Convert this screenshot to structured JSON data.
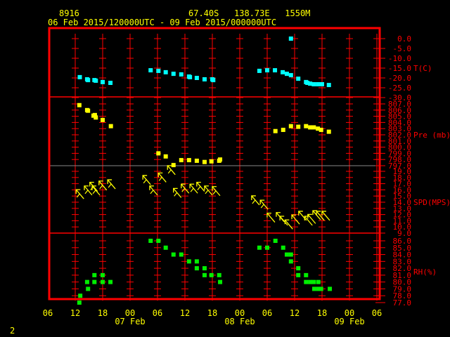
{
  "header": {
    "station": "8916",
    "location": "67.40S   138.73E   1550M",
    "period": "06 Feb 2015/120000UTC - 09 Feb 2015/000000UTC"
  },
  "page_number": "2",
  "colors": {
    "frame": "#ff0000",
    "text": "#ffff00",
    "temp": "#00ffff",
    "pressure": "#ffff00",
    "wind": "#ffff00",
    "rh": "#00ee00"
  },
  "chart_data": {
    "type": "scatter",
    "x_units": "hours after 06 Feb 2015 06UTC",
    "xlim": [
      0,
      72
    ],
    "x_ticks": [
      {
        "h": 0,
        "label": "06"
      },
      {
        "h": 6,
        "label": "12"
      },
      {
        "h": 12,
        "label": "18"
      },
      {
        "h": 18,
        "label": "00"
      },
      {
        "h": 24,
        "label": "06"
      },
      {
        "h": 30,
        "label": "12"
      },
      {
        "h": 36,
        "label": "18"
      },
      {
        "h": 42,
        "label": "00"
      },
      {
        "h": 48,
        "label": "06"
      },
      {
        "h": 54,
        "label": "12"
      },
      {
        "h": 60,
        "label": "18"
      },
      {
        "h": 66,
        "label": "00"
      },
      {
        "h": 72,
        "label": "06"
      }
    ],
    "date_labels": [
      {
        "h": 18,
        "label": "07 Feb"
      },
      {
        "h": 42,
        "label": "08 Feb"
      },
      {
        "h": 66,
        "label": "09 Feb"
      }
    ],
    "panels": [
      {
        "name": "temperature",
        "label": "T(C)",
        "ylim": [
          -30,
          0
        ],
        "ticks": [
          "0.0",
          "-5.0",
          "-10.0",
          "-15.0",
          "-20.0",
          "-25.0",
          "-30.0"
        ],
        "points": [
          [
            7,
            -19.6
          ],
          [
            8.6,
            -20.7
          ],
          [
            8.8,
            -21.1
          ],
          [
            10.2,
            -21.1
          ],
          [
            10.5,
            -21.4
          ],
          [
            12,
            -22.1
          ],
          [
            13.7,
            -22.5
          ],
          [
            22.5,
            -16.1
          ],
          [
            24.2,
            -16.4
          ],
          [
            25.8,
            -17.1
          ],
          [
            27.5,
            -17.9
          ],
          [
            29.2,
            -18.2
          ],
          [
            30.9,
            -19.3
          ],
          [
            31.1,
            -19.6
          ],
          [
            32.6,
            -20
          ],
          [
            34.3,
            -20.7
          ],
          [
            36,
            -20.7
          ],
          [
            36.2,
            -21.1
          ],
          [
            46.3,
            -16.4
          ],
          [
            48,
            -16.1
          ],
          [
            49.7,
            -16.1
          ],
          [
            51.4,
            -17.1
          ],
          [
            52.3,
            -17.9
          ],
          [
            53.2,
            -18.6
          ],
          [
            53.2,
            0
          ],
          [
            54.8,
            -20.4
          ],
          [
            56.5,
            -22.1
          ],
          [
            56.8,
            -22.5
          ],
          [
            57.4,
            -22.9
          ],
          [
            58.2,
            -23.2
          ],
          [
            59.1,
            -23.2
          ],
          [
            60,
            -23.2
          ],
          [
            61.5,
            -23.6
          ]
        ]
      },
      {
        "name": "pressure",
        "label": "Pre (mb)",
        "ylim": [
          797,
          807
        ],
        "ticks": [
          "807.0",
          "806.0",
          "805.0",
          "804.0",
          "803.0",
          "802.0",
          "801.0",
          "800.0",
          "799.0",
          "798.0",
          "797.0"
        ],
        "points": [
          [
            6.9,
            806.8
          ],
          [
            8.6,
            806
          ],
          [
            8.8,
            805.9
          ],
          [
            10,
            805.1
          ],
          [
            10.3,
            805.2
          ],
          [
            10.5,
            804.8
          ],
          [
            12,
            804.4
          ],
          [
            13.8,
            803.4
          ],
          [
            24.2,
            799
          ],
          [
            25.8,
            798.5
          ],
          [
            27.5,
            797.1
          ],
          [
            29.2,
            797.9
          ],
          [
            30.9,
            797.9
          ],
          [
            32.6,
            797.8
          ],
          [
            34.3,
            797.6
          ],
          [
            35.8,
            797.7
          ],
          [
            37.5,
            797.8
          ],
          [
            37.7,
            798
          ],
          [
            49.8,
            802.6
          ],
          [
            51.5,
            802.8
          ],
          [
            53.2,
            803.4
          ],
          [
            54.8,
            803.3
          ],
          [
            56.5,
            803.4
          ],
          [
            57.4,
            803.2
          ],
          [
            58.2,
            803.2
          ],
          [
            59.1,
            803
          ],
          [
            59.8,
            802.8
          ],
          [
            61.5,
            802.5
          ]
        ]
      },
      {
        "name": "wind_speed",
        "label": "SPD(MPS)",
        "ylim": [
          9,
          19
        ],
        "ticks": [
          "19.0",
          "18.0",
          "17.0",
          "16.0",
          "15.0",
          "14.0",
          "13.0",
          "12.0",
          "11.0",
          "10.0",
          "9.0"
        ],
        "points": [
          [
            6.5,
            15.8
          ],
          [
            8.3,
            16.4
          ],
          [
            9.5,
            17
          ],
          [
            10,
            16.4
          ],
          [
            11.5,
            17.2
          ],
          [
            13.4,
            17.4
          ],
          [
            21.1,
            18.1
          ],
          [
            22.6,
            16.4
          ],
          [
            24.5,
            18.5
          ],
          [
            26.5,
            19.7
          ],
          [
            27.8,
            16
          ],
          [
            29.5,
            16.7
          ],
          [
            31.4,
            16.7
          ],
          [
            32.9,
            17
          ],
          [
            34.6,
            16.4
          ],
          [
            36.3,
            16.3
          ],
          [
            44.9,
            14.8
          ],
          [
            46.8,
            14.1
          ],
          [
            48.3,
            12
          ],
          [
            50.3,
            12.1
          ],
          [
            51.1,
            11.5
          ],
          [
            52.2,
            10.9
          ],
          [
            53.7,
            11.7
          ],
          [
            55.2,
            12.3
          ],
          [
            56.5,
            11.5
          ],
          [
            57.2,
            11.8
          ],
          [
            58.3,
            12.4
          ],
          [
            59.1,
            12.3
          ],
          [
            60.3,
            12.3
          ]
        ]
      },
      {
        "name": "relative_humidity",
        "label": "RH(%)",
        "ylim": [
          77,
          86
        ],
        "ticks": [
          "86.0",
          "85.0",
          "84.0",
          "83.0",
          "82.0",
          "81.0",
          "80.0",
          "79.0",
          "78.0",
          "77.0"
        ],
        "points": [
          [
            7.1,
            78
          ],
          [
            6.9,
            77
          ],
          [
            8.8,
            79
          ],
          [
            8.6,
            80
          ],
          [
            10.2,
            81
          ],
          [
            10.2,
            80
          ],
          [
            12,
            81
          ],
          [
            12,
            80
          ],
          [
            13.7,
            80
          ],
          [
            22.5,
            86
          ],
          [
            24.2,
            86
          ],
          [
            25.8,
            85
          ],
          [
            27.5,
            84
          ],
          [
            29.2,
            84
          ],
          [
            30.9,
            83
          ],
          [
            32.6,
            83
          ],
          [
            32.6,
            82
          ],
          [
            34.3,
            82
          ],
          [
            34.3,
            81
          ],
          [
            35.8,
            81
          ],
          [
            37.5,
            81
          ],
          [
            37.7,
            80
          ],
          [
            46.3,
            85
          ],
          [
            48,
            85
          ],
          [
            49.8,
            86
          ],
          [
            51.5,
            85
          ],
          [
            52.3,
            84
          ],
          [
            53.2,
            84
          ],
          [
            53.2,
            83
          ],
          [
            54.8,
            82
          ],
          [
            54.8,
            81
          ],
          [
            56.5,
            81
          ],
          [
            56.5,
            80
          ],
          [
            57.4,
            80
          ],
          [
            58.2,
            80
          ],
          [
            59.2,
            80
          ],
          [
            58.3,
            79
          ],
          [
            59.2,
            79
          ],
          [
            59.8,
            79
          ],
          [
            61.7,
            79
          ]
        ]
      }
    ]
  }
}
